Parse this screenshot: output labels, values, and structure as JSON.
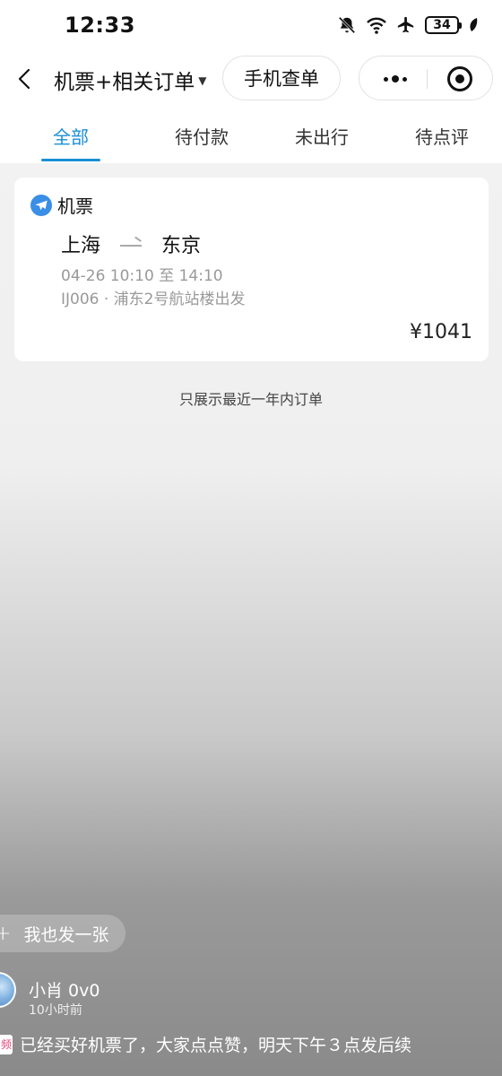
{
  "status_bar": {
    "time": "12:33",
    "battery": "34"
  },
  "nav": {
    "title": "机票+相关订单",
    "phone_query": "手机查单"
  },
  "tabs": [
    {
      "label": "全部",
      "active": true
    },
    {
      "label": "待付款",
      "active": false
    },
    {
      "label": "未出行",
      "active": false
    },
    {
      "label": "待点评",
      "active": false
    }
  ],
  "order": {
    "category": "机票",
    "from": "上海",
    "to": "东京",
    "time": "04-26 10:10 至 14:10",
    "info": "IJ006 · 浦东2号航站楼出发",
    "price": "¥1041"
  },
  "notice": "只展示最近一年内订单",
  "overlay": {
    "post_label": "我也发一张",
    "username": "小肖 0v0",
    "time_ago": "10小时前",
    "comment_tag": "频",
    "comment": "已经买好机票了，大家点点赞，明天下午３点发后续"
  },
  "colors": {
    "accent": "#1a8fd6",
    "plane_badge": "#3a8ee6"
  }
}
